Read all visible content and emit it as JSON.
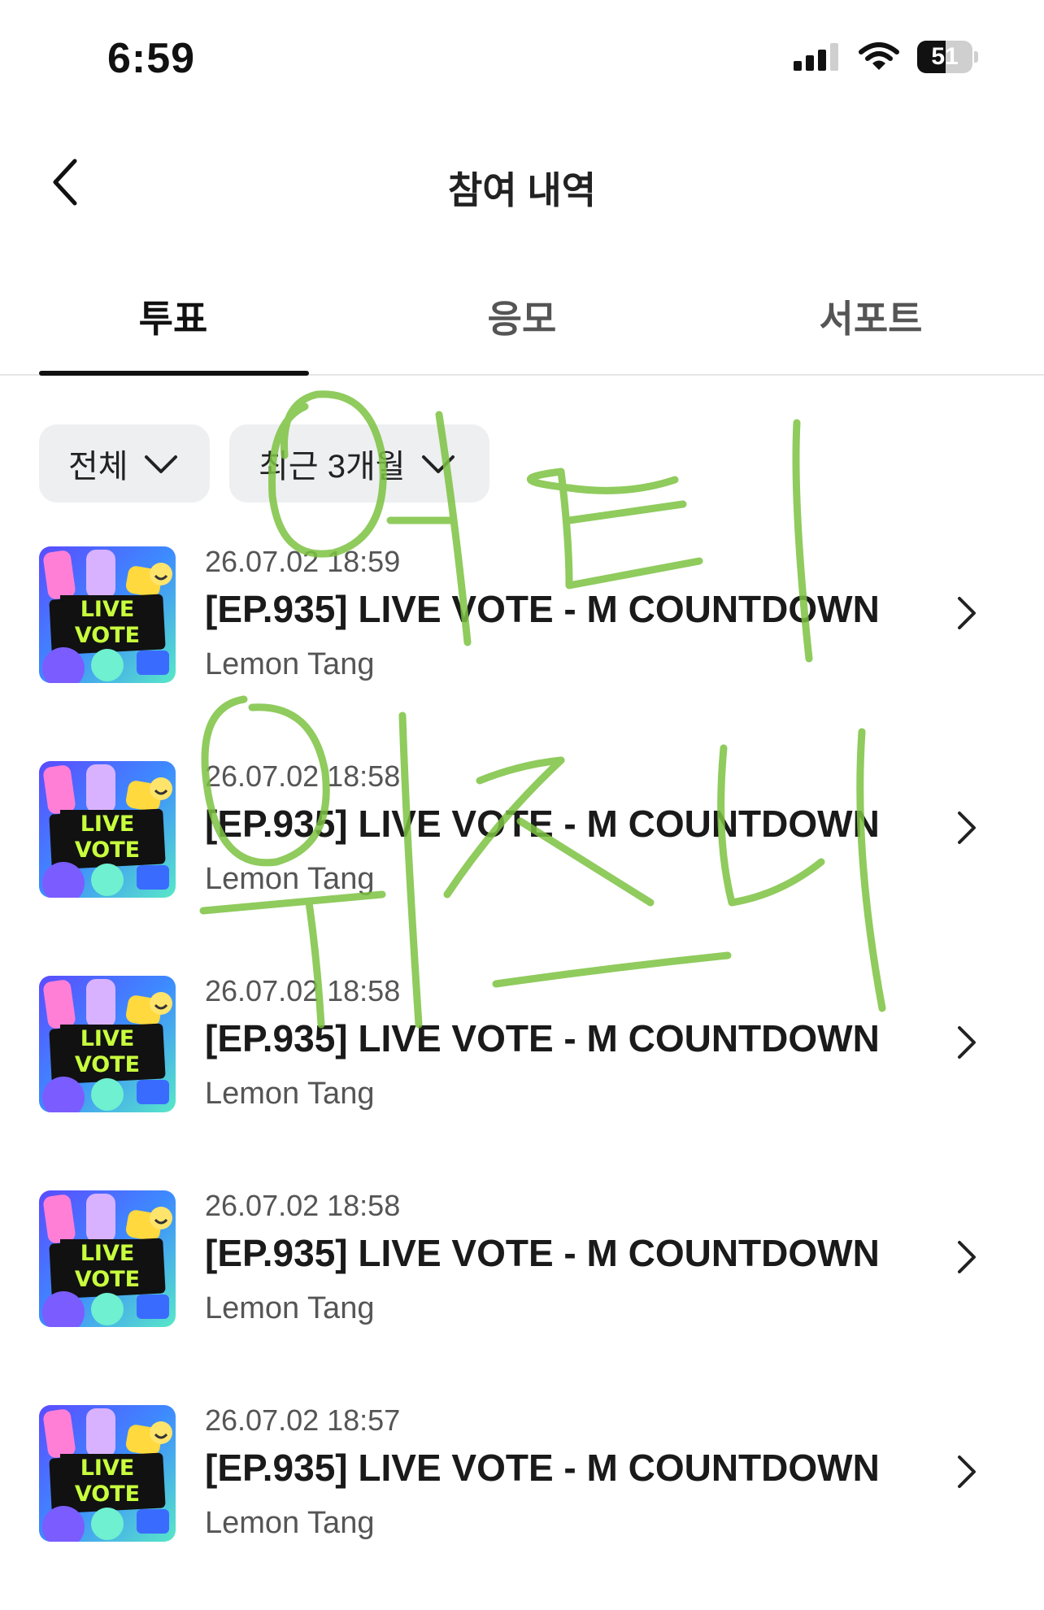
{
  "status_bar": {
    "time": "6:59",
    "battery_level": "51",
    "battery_fraction": 0.51,
    "icons": [
      "cellular-signal-icon",
      "wifi-icon",
      "battery-icon"
    ]
  },
  "header": {
    "title": "참여 내역",
    "back_icon": "chevron-left-icon"
  },
  "tabs": [
    {
      "label": "투표",
      "active": true
    },
    {
      "label": "응모",
      "active": false
    },
    {
      "label": "서포트",
      "active": false
    }
  ],
  "filters": {
    "type": "전체",
    "period": "최근 3개월"
  },
  "items": [
    {
      "date": "26.07.02 18:59",
      "title": "[EP.935] LIVE VOTE - M COUNTDOWN",
      "artist": "Lemon Tang"
    },
    {
      "date": "26.07.02 18:58",
      "title": "[EP.935] LIVE VOTE - M COUNTDOWN",
      "artist": "Lemon Tang"
    },
    {
      "date": "26.07.02 18:58",
      "title": "[EP.935] LIVE VOTE - M COUNTDOWN",
      "artist": "Lemon Tang"
    },
    {
      "date": "26.07.02 18:58",
      "title": "[EP.935] LIVE VOTE - M COUNTDOWN",
      "artist": "Lemon Tang"
    },
    {
      "date": "26.07.02 18:57",
      "title": "[EP.935] LIVE VOTE - M COUNTDOWN",
      "artist": "Lemon Tang"
    }
  ],
  "thumbnail": {
    "line1": "LIVE",
    "line2": "VOTE"
  },
  "colors": {
    "accent": "#111111",
    "chip_bg": "#eeeff1",
    "scribble": "#7cc241"
  }
}
